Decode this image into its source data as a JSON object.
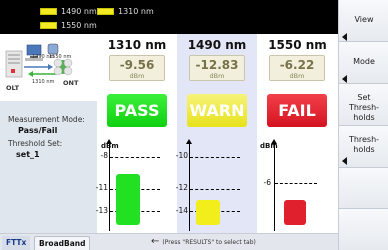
{
  "header": {
    "items": [
      {
        "label": "1490 nm",
        "color": "#f2ea22"
      },
      {
        "label": "1310 nm",
        "color": "#f2ea22"
      },
      {
        "label": "1550 nm",
        "color": "#f2ea22"
      }
    ]
  },
  "diagram": {
    "olt_label": "OLT",
    "ont_label": "ONT",
    "wl_top": "1490 nm",
    "wl_top2": "1550 nm",
    "wl_bottom": "1310 nm"
  },
  "info": {
    "measurement_mode_label": "Measurement Mode:",
    "measurement_mode_value": "Pass/Fail",
    "threshold_set_label": "Threshold Set:",
    "threshold_set_value": "set_1"
  },
  "columns": [
    {
      "wavelength": "1310 nm",
      "power": "-9.56",
      "unit": "dBm",
      "status": "PASS",
      "status_color": "#22e022",
      "gauge": {
        "unit": "dBm",
        "ticks": [
          "-8",
          "-11",
          "-13"
        ],
        "value": -9.56,
        "bar_color": "#22e022"
      }
    },
    {
      "wavelength": "1490 nm",
      "power": "-12.83",
      "unit": "dBm",
      "status": "WARN",
      "status_color": "#ede72a",
      "gauge": {
        "unit": "dBm",
        "ticks": [
          "-10",
          "-12",
          "-14"
        ],
        "value": -12.83,
        "bar_color": "#f2ee1c"
      }
    },
    {
      "wavelength": "1550 nm",
      "power": "-6.22",
      "unit": "dBm",
      "status": "FAIL",
      "status_color": "#e0202c",
      "gauge": {
        "unit": "dBm",
        "ticks": [
          "-6"
        ],
        "value": -6.22,
        "bar_color": "#e0202c"
      }
    }
  ],
  "tabs": [
    {
      "label": "FTTx",
      "active": true
    },
    {
      "label": "BroadBand",
      "active": false
    }
  ],
  "hint": "(Press \"RESULTS\" to select tab)",
  "sidebar": {
    "buttons": [
      {
        "label": "View"
      },
      {
        "label": "Mode"
      },
      {
        "label_lines": [
          "Set",
          "Thresh-",
          "holds"
        ]
      },
      {
        "label_lines": [
          "Thresh-",
          "holds"
        ]
      }
    ]
  }
}
